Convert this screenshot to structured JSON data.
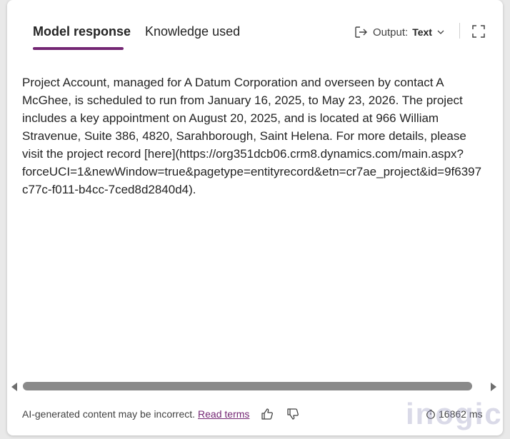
{
  "tabs": [
    {
      "label": "Model response",
      "active": true
    },
    {
      "label": "Knowledge used",
      "active": false
    }
  ],
  "output": {
    "label": "Output:",
    "value": "Text"
  },
  "response": {
    "text": "Project Account, managed for A Datum Corporation and overseen by contact A\nMcGhee, is scheduled to run from January 16, 2025, to May 23, 2026. The project\nincludes a key appointment on August 20, 2025, and is located at 966 William\nStravenue, Suite 386, 4820, Sarahborough, Saint Helena. For more details, please\nvisit the project record [here](https://org351dcb06.crm8.dynamics.com/main.aspx?\nforceUCI=1&newWindow=true&pagetype=entityrecord&etn=cr7ae_project&id=9f6397\nc77c-f011-b4cc-7ced8d2840d4)."
  },
  "scrollbar": {
    "position": 0.0,
    "visible_fraction": 0.97
  },
  "footer": {
    "disclaimer": "AI-generated content may be incorrect.",
    "read_terms": "Read terms"
  },
  "timing": {
    "value": "16862 ms"
  },
  "watermark": "inogic",
  "colors": {
    "accent": "#742774",
    "text": "#242424"
  },
  "icons": [
    "output-arrow-icon",
    "chevron-down-icon",
    "expand-icon",
    "thumbs-up-icon",
    "thumbs-down-icon",
    "timer-icon"
  ]
}
